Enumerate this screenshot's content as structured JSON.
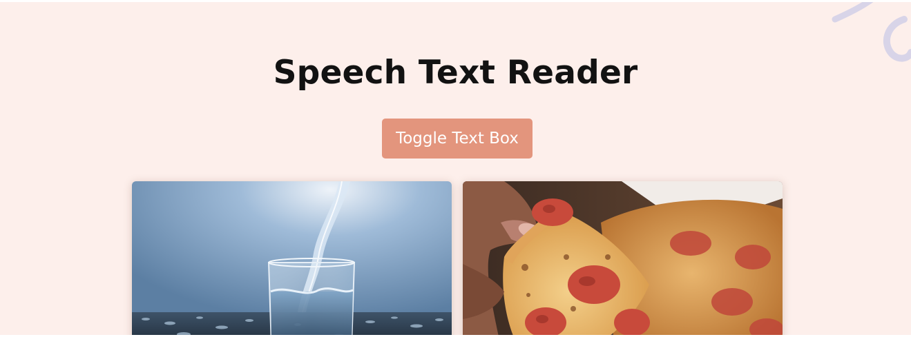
{
  "header": {
    "title": "Speech Text Reader"
  },
  "controls": {
    "toggle_label": "Toggle Text Box"
  },
  "cards": [
    {
      "image": "water-glass-image",
      "label": ""
    },
    {
      "image": "pizza-slice-image",
      "label": ""
    }
  ],
  "colors": {
    "background": "#fdefeb",
    "button": "#e3957d",
    "button_text": "#ffffff",
    "title": "#121212",
    "decoration": "#d8d4e8"
  }
}
